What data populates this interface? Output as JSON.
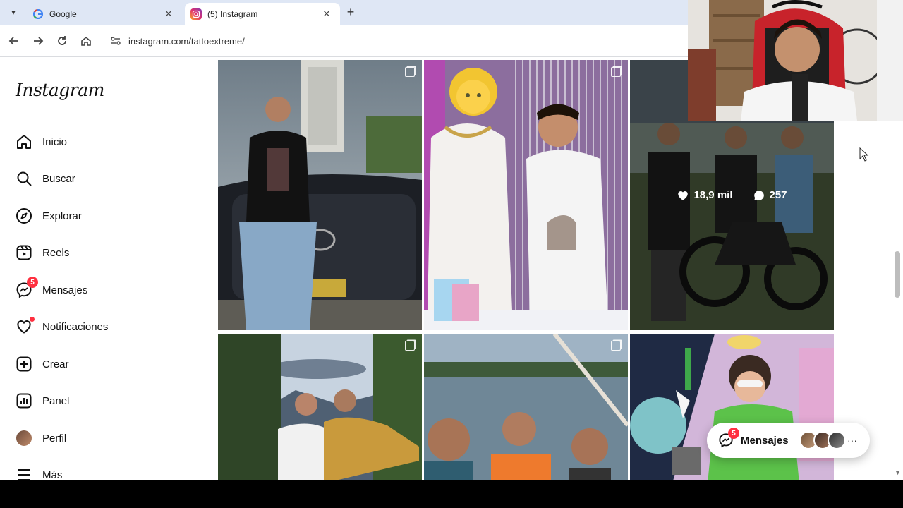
{
  "browser": {
    "tabs": [
      {
        "title": "Google",
        "icon": "google-icon",
        "active": false
      },
      {
        "title": "(5) Instagram",
        "icon": "instagram-icon",
        "active": true
      }
    ],
    "url": "instagram.com/tattoextreme/"
  },
  "sidebar": {
    "logo": "Instagram",
    "items": [
      {
        "label": "Inicio",
        "icon": "home-icon"
      },
      {
        "label": "Buscar",
        "icon": "search-icon"
      },
      {
        "label": "Explorar",
        "icon": "compass-icon"
      },
      {
        "label": "Reels",
        "icon": "reels-icon"
      },
      {
        "label": "Mensajes",
        "icon": "messenger-icon",
        "badge": "5"
      },
      {
        "label": "Notificaciones",
        "icon": "heart-icon",
        "dot": true
      },
      {
        "label": "Crear",
        "icon": "plus-square-icon"
      },
      {
        "label": "Panel",
        "icon": "chart-icon"
      },
      {
        "label": "Perfil",
        "icon": "avatar"
      },
      {
        "label": "Más",
        "icon": "menu-icon"
      }
    ]
  },
  "grid": {
    "hover_post": {
      "likes": "18,9 mil",
      "comments": "257"
    }
  },
  "messages_popup": {
    "label": "Mensajes",
    "badge": "5",
    "more": "···"
  },
  "colors": {
    "badge": "#ff3040",
    "tabstrip": "#dfe7f5"
  }
}
